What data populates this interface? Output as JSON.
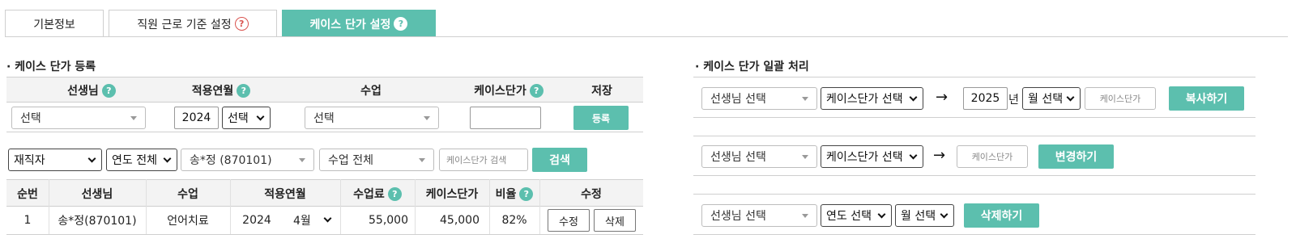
{
  "tabs": [
    {
      "label": "기본정보",
      "help": false
    },
    {
      "label": "직원 근로 기준 설정",
      "help": true
    },
    {
      "label": "케이스 단가 설정",
      "help": true
    }
  ],
  "register": {
    "title": "· 케이스 단가 등록",
    "headers": {
      "teacher": "선생님",
      "apply_month": "적용연월",
      "class": "수업",
      "case_price": "케이스단가",
      "save": "저장"
    },
    "teacher_select": "선택",
    "year_value": "2024",
    "month_select": "선택",
    "class_select": "선택",
    "case_price_value": "",
    "register_button": "등록"
  },
  "filter": {
    "status": "재직자",
    "year": "연도 전체",
    "teacher": "송*정 (870101)",
    "class": "수업 전체",
    "search_placeholder": "케이스단가 검색",
    "search_button": "검색"
  },
  "table": {
    "columns": [
      "순번",
      "선생님",
      "수업",
      "적용연월",
      "수업료",
      "케이스단가",
      "비율",
      "수정"
    ],
    "rows": [
      {
        "no": "1",
        "teacher": "송*정(870101)",
        "class": "언어치료",
        "year": "2024",
        "month": "4월",
        "fee": "55,000",
        "case_price": "45,000",
        "ratio": "82%",
        "edit_button": "수정",
        "delete_button": "삭제"
      }
    ]
  },
  "bulk": {
    "title": "· 케이스 단가 일괄 처리",
    "copy": {
      "teacher_select": "선생님 선택",
      "price_select": "케이스단가 선택",
      "arrow": "→",
      "year_value": "2025",
      "year_suffix": "년",
      "month_select": "월 선택",
      "price_placeholder": "케이스단가",
      "button": "복사하기"
    },
    "change": {
      "teacher_select": "선생님 선택",
      "price_select": "케이스단가 선택",
      "arrow": "→",
      "price_placeholder": "케이스단가",
      "button": "변경하기"
    },
    "delete": {
      "teacher_select": "선생님 선택",
      "year_select": "연도 선택",
      "month_select": "월 선택",
      "button": "삭제하기"
    }
  },
  "help_glyph": "?",
  "colors": {
    "accent": "#5cbfae",
    "help_red": "#d9534f"
  }
}
